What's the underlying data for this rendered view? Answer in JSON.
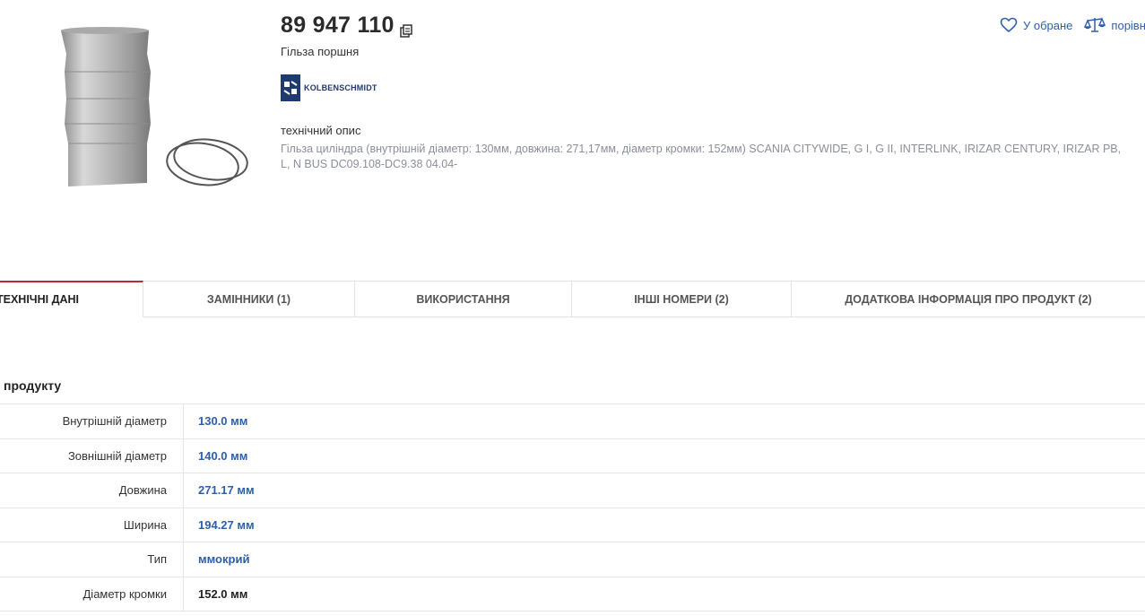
{
  "product": {
    "part_number": "89 947 110",
    "name": "Гільза поршня",
    "brand": "KOLBENSCHMIDT",
    "brand_color": "#1f3a6e"
  },
  "actions": {
    "favorite_label": "У обране",
    "compare_label": "порівн"
  },
  "description": {
    "title": "технічний опис",
    "line1": "Гільза циліндра (внутрішній діаметр: 130мм, довжина: 271,17мм, діаметр кромки: 152мм) SCANIA CITYWIDE, G I, G II, INTERLINK, IRIZAR CENTURY, IRIZAR PB,",
    "line2": "L, N BUS DC09.108-DC9.38 04.04-"
  },
  "tabs": [
    {
      "label": "ТЕХНІЧНІ ДАНІ",
      "active": true
    },
    {
      "label": "ЗАМІННИКИ (1)",
      "active": false
    },
    {
      "label": "ВИКОРИСТАННЯ",
      "active": false
    },
    {
      "label": "ІНШІ НОМЕРИ (2)",
      "active": false
    },
    {
      "label": "ДОДАТКОВА ІНФОРМАЦІЯ ПРО ПРОДУКТ (2)",
      "active": false
    }
  ],
  "specs": {
    "section_title": "продукту",
    "rows": [
      {
        "label": "Внутрішній діаметр",
        "value": "130.0 мм",
        "link": true
      },
      {
        "label": "Зовнішній діаметр",
        "value": "140.0 мм",
        "link": true
      },
      {
        "label": "Довжина",
        "value": "271.17 мм",
        "link": true
      },
      {
        "label": "Ширина",
        "value": "194.27 мм",
        "link": true
      },
      {
        "label": "Тип",
        "value": "ммокрий",
        "link": true
      },
      {
        "label": "Діаметр кромки",
        "value": "152.0 мм",
        "link": false
      }
    ]
  },
  "colors": {
    "accent_link": "#2d5fa8",
    "active_tab": "#b32d3a"
  },
  "icons": {
    "copy": "copy-icon",
    "favorite": "heart-icon",
    "compare": "scales-icon"
  }
}
